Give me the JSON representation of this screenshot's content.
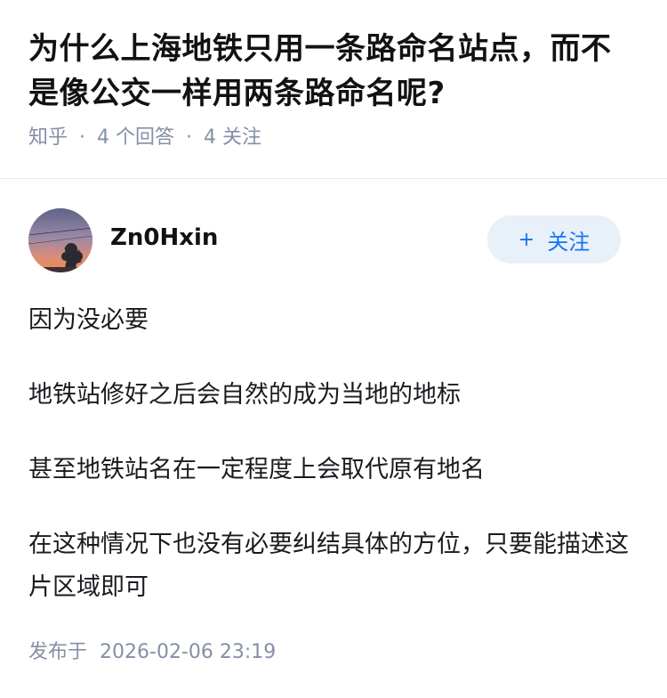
{
  "question": {
    "title": "为什么上海地铁只用一条路命名站点，而不是像公交一样用两条路命名呢?",
    "source": "知乎",
    "separator": "·",
    "answer_count": "4 个回答",
    "follower_count": "4 关注"
  },
  "author": {
    "name": "Zn0Hxin",
    "avatar_icon": "sunset-tree-avatar"
  },
  "follow_button": {
    "icon": "+",
    "label": "关注"
  },
  "answer": {
    "paragraphs": [
      "因为没必要",
      "地铁站修好之后会自然的成为当地的地标",
      "甚至地铁站名在一定程度上会取代原有地名",
      "在这种情况下也没有必要纠结具体的方位，只要能描述这片区域即可"
    ],
    "published_label": "发布于",
    "published_time": "2026-02-06 23:19"
  },
  "colors": {
    "accent": "#1772f6",
    "follow_bg": "#e8f0fa",
    "meta_text": "#8590a6",
    "body_text": "#191b1f"
  }
}
